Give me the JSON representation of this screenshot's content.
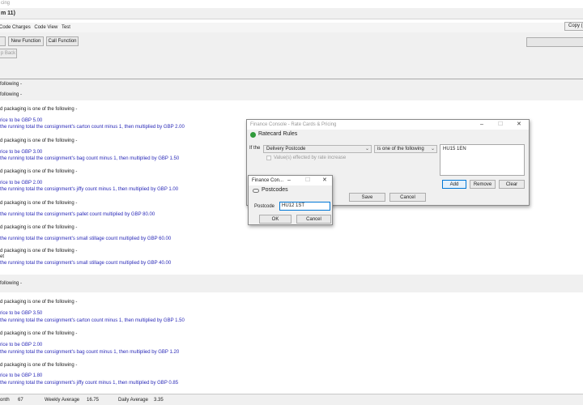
{
  "window": {
    "title_fragment": "cing",
    "subtitle_fragment": "m 11)"
  },
  "menu": {
    "items": [
      "Code Charges",
      "Code View",
      "Test"
    ],
    "copy_label": "Copy ("
  },
  "toolbar": {
    "new_function_label": "New Function",
    "call_function_label": "Call Function",
    "back_label": "p Back"
  },
  "code": {
    "section1_header": "following -",
    "section2_header": "following -",
    "lines1": [
      {
        "text": "d packaging is one of the following -",
        "style": "plain"
      },
      {
        "text": "rice to be GBP 5.00",
        "style": "blue"
      },
      {
        "text": "the running total the consignment's carton count minus 1, then multiplied by GBP 2.00",
        "style": "blue"
      },
      {
        "text": "d packaging is one of the following -",
        "style": "plain"
      },
      {
        "text": "rice to be GBP 3.00",
        "style": "blue"
      },
      {
        "text": "the running total the consignment's bag count minus 1, then multiplied by GBP 1.50",
        "style": "blue"
      },
      {
        "text": "d packaging is one of the following -",
        "style": "plain"
      },
      {
        "text": "rice to be GBP 2.00",
        "style": "blue"
      },
      {
        "text": "the running total the consignment's jiffy count minus 1, then multiplied by GBP 1.00",
        "style": "blue"
      },
      {
        "text": "d packaging is one of the following -",
        "style": "plain"
      },
      {
        "text": "the running total the consignment's pallet count multiplied by GBP 80.00",
        "style": "blue"
      },
      {
        "text": "d packaging is one of the following -",
        "style": "plain"
      },
      {
        "text": "the running total the consignment's small stillage count multiplied by GBP 60.00",
        "style": "blue"
      },
      {
        "text": "d packaging is one of the following -",
        "style": "plain"
      },
      {
        "text": "et",
        "style": "plain"
      },
      {
        "text": "the running total the consignment's small stillage count multiplied by GBP 40.00",
        "style": "blue"
      }
    ],
    "section3_header": "following -",
    "lines2": [
      {
        "text": "d packaging is one of the following -",
        "style": "plain"
      },
      {
        "text": "rice to be GBP 3.50",
        "style": "blue"
      },
      {
        "text": "the running total the consignment's carton count minus 1, then multiplied by GBP 1.50",
        "style": "blue"
      },
      {
        "text": "d packaging is one of the following -",
        "style": "plain"
      },
      {
        "text": "rice to be GBP 2.00",
        "style": "blue"
      },
      {
        "text": "the running total the consignment's bag count minus 1, then multiplied by GBP 1.20",
        "style": "blue"
      },
      {
        "text": "d packaging is one of the following -",
        "style": "plain"
      },
      {
        "text": "rice to be GBP 1.80",
        "style": "blue"
      },
      {
        "text": "the running total the consignment's jiffy count minus 1, then multiplied by GBP 0.85",
        "style": "blue"
      }
    ]
  },
  "status": {
    "month_label": "onth",
    "month_value": "67",
    "weekly_label": "Weekly Average",
    "weekly_value": "16.75",
    "daily_label": "Daily Average",
    "daily_value": "3.35"
  },
  "ratecard": {
    "title": "Finance Console - Rate Cards & Pricing",
    "header": "Ratecard Rules",
    "if_label": "If the",
    "field_value": "Delivery Postcode",
    "operator_value": "is one of the following",
    "checkbox_label": "Value(s) effected by rate increase",
    "list_value": "HU15 1EN",
    "add_label": "Add",
    "remove_label": "Remove",
    "clear_label": "Clear",
    "save_label": "Save",
    "cancel_label": "Cancel"
  },
  "postcodes": {
    "title": "Finance Con...",
    "header": "Postcodes",
    "postcode_label": "Postcode",
    "postcode_value": "HU12 1ST",
    "ok_label": "OK",
    "cancel_label": "Cancel"
  },
  "colors": {
    "code_blue": "#2a2ab8",
    "accent_blue": "#0078d7",
    "header_green": "#2f9a3a"
  }
}
